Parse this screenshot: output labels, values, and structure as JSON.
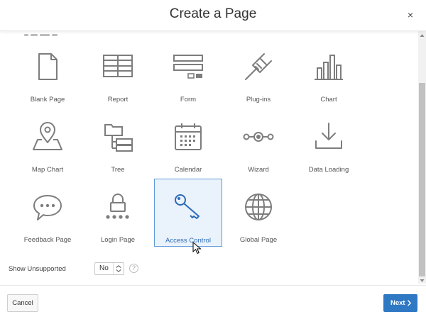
{
  "dialog": {
    "title": "Create a Page",
    "close_label": "×"
  },
  "tiles": [
    {
      "label": "Blank Page",
      "icon": "blank-page-icon"
    },
    {
      "label": "Report",
      "icon": "report-icon"
    },
    {
      "label": "Form",
      "icon": "form-icon"
    },
    {
      "label": "Plug-ins",
      "icon": "plug-icon"
    },
    {
      "label": "Chart",
      "icon": "chart-icon"
    },
    {
      "label": "Map Chart",
      "icon": "map-pin-icon"
    },
    {
      "label": "Tree",
      "icon": "tree-icon"
    },
    {
      "label": "Calendar",
      "icon": "calendar-icon"
    },
    {
      "label": "Wizard",
      "icon": "wizard-icon"
    },
    {
      "label": "Data Loading",
      "icon": "download-tray-icon"
    },
    {
      "label": "Feedback Page",
      "icon": "speech-bubble-icon"
    },
    {
      "label": "Login Page",
      "icon": "lock-icon"
    },
    {
      "label": "Access Control",
      "icon": "key-icon",
      "selected": true
    },
    {
      "label": "Global Page",
      "icon": "globe-icon"
    }
  ],
  "show_unsupported": {
    "label": "Show Unsupported",
    "value": "No",
    "help": "?"
  },
  "footer": {
    "cancel_label": "Cancel",
    "next_label": "Next"
  },
  "colors": {
    "accent": "#2f78c4",
    "selected_bg": "#eaf2fb",
    "selected_border": "#5d9ad6",
    "icon": "#7d7d7d"
  }
}
